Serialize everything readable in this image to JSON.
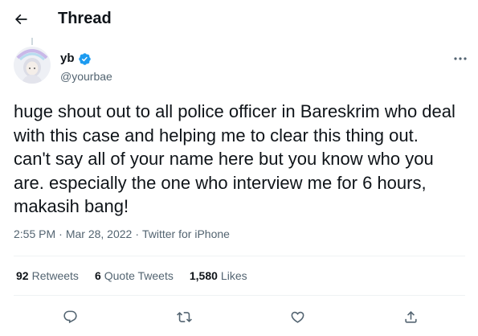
{
  "header": {
    "title": "Thread"
  },
  "author": {
    "display_name": "yb",
    "handle": "@yourbae",
    "verified": true
  },
  "tweet": {
    "text": "huge shout out to all police officer in Bareskrim who deal with this case and helping me to clear this thing out. can't say all of your name here but you know who you are. especially the one who interview me for 6 hours, makasih bang!",
    "time": "2:55 PM",
    "date": "Mar 28, 2022",
    "separator": "·",
    "source": "Twitter for iPhone"
  },
  "stats": {
    "retweets": {
      "count": "92",
      "label": "Retweets"
    },
    "quote_tweets": {
      "count": "6",
      "label": "Quote Tweets"
    },
    "likes": {
      "count": "1,580",
      "label": "Likes"
    }
  },
  "colors": {
    "text_primary": "#0f1419",
    "text_secondary": "#536471",
    "icon_gray": "#536471",
    "verified_blue": "#1d9bf0",
    "divider": "#eff3f4"
  },
  "icons": {
    "back": "arrow-left-icon",
    "verified": "verified-badge-icon",
    "more": "more-horizontal-icon",
    "reply": "reply-icon",
    "retweet": "retweet-icon",
    "like": "heart-icon",
    "share": "share-icon"
  }
}
